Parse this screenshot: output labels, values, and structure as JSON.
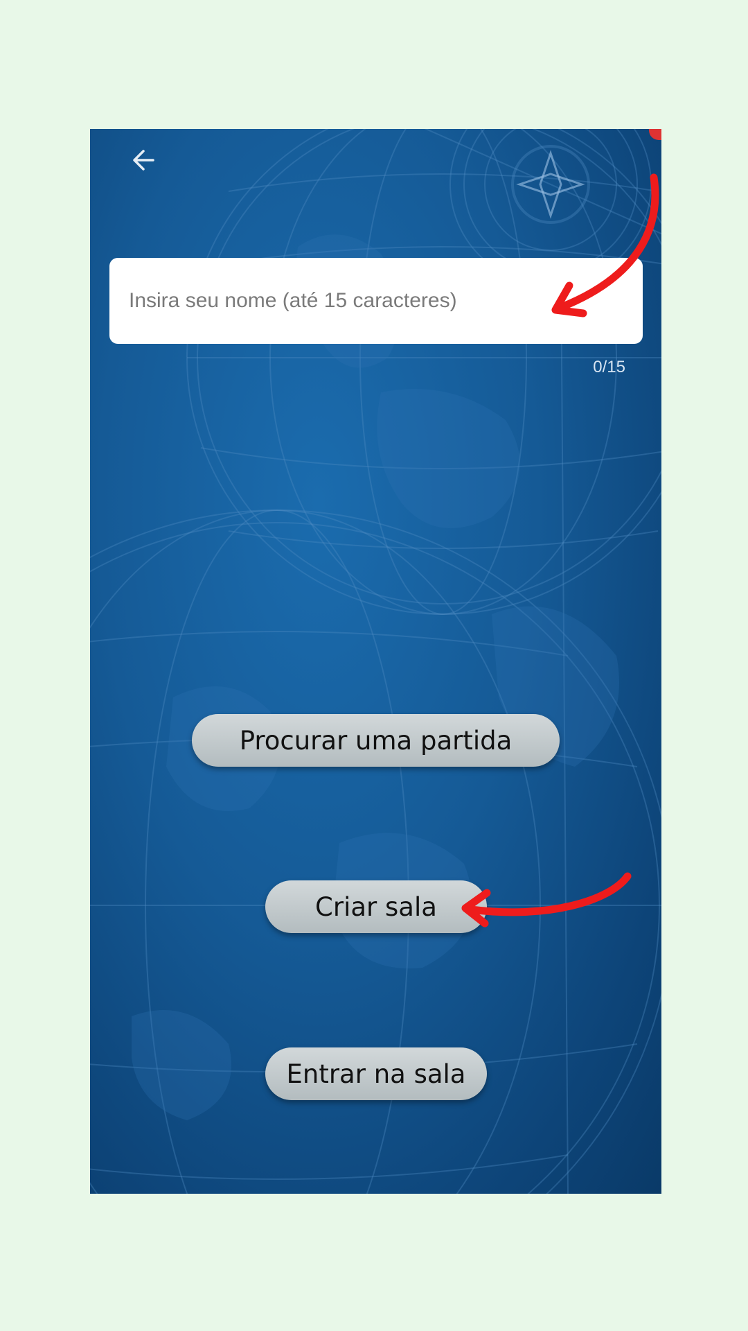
{
  "screen": {
    "back_icon": "arrow-left-icon",
    "name_input": {
      "placeholder": "Insira seu nome (até 15 caracteres)",
      "value": ""
    },
    "char_counter": "0/15",
    "buttons": {
      "find_match": "Procurar uma partida",
      "create_room": "Criar sala",
      "join_room": "Entrar na sala"
    }
  },
  "colors": {
    "page_background": "#e8f8e8",
    "app_background": "#155a96",
    "button_fill": "#c3cacc",
    "annotation_arrow": "#ee1c1c"
  }
}
